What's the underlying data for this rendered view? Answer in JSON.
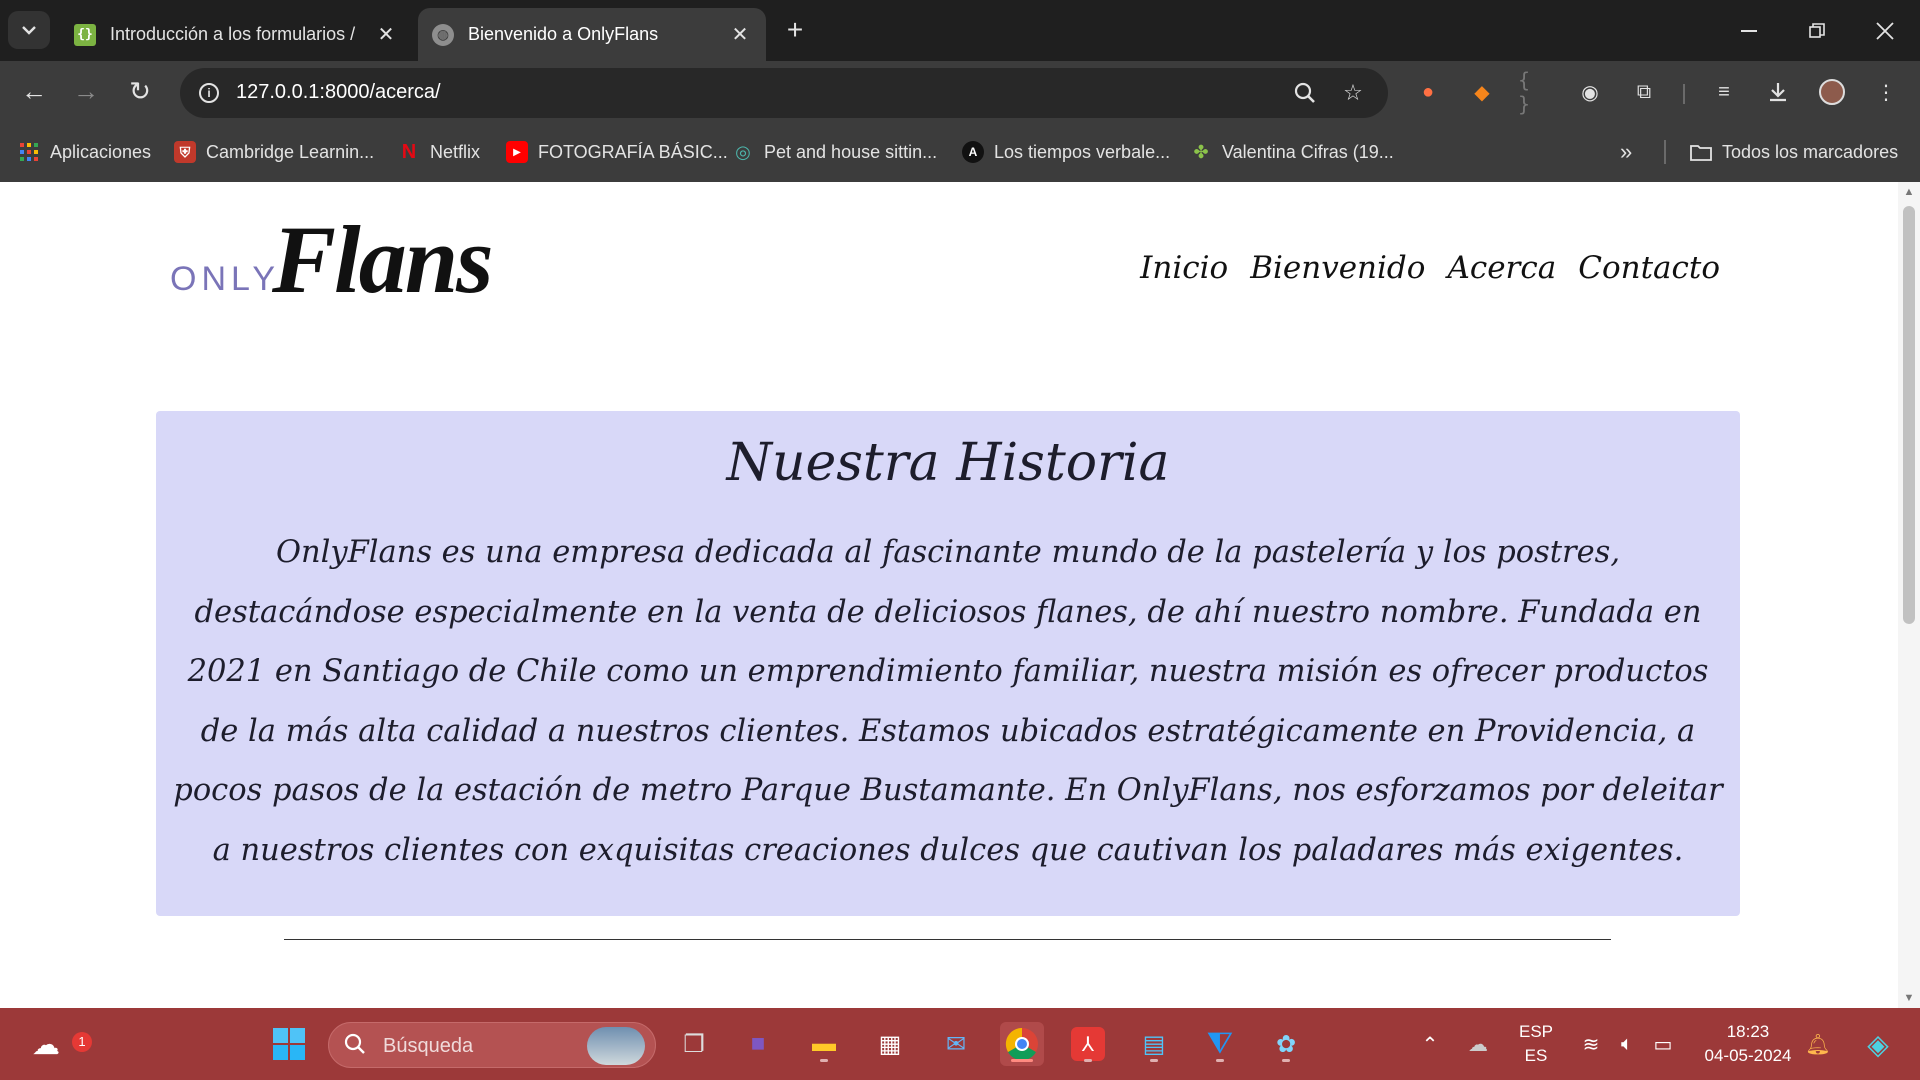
{
  "browser": {
    "tabs": [
      {
        "title": "Introducción a los formularios /",
        "favicon": "braces-icon",
        "active": false
      },
      {
        "title": "Bienvenido a OnlyFlans",
        "favicon": "globe-icon",
        "active": true
      }
    ],
    "address": "127.0.0.1:8000/acerca/",
    "bookmarks": [
      {
        "label": "Aplicaciones",
        "icon": "apps-grid-icon"
      },
      {
        "label": "Cambridge Learnin...",
        "icon": "cambridge-shield-icon"
      },
      {
        "label": "Netflix",
        "icon": "netflix-icon"
      },
      {
        "label": "FOTOGRAFÍA BÁSIC...",
        "icon": "youtube-icon"
      },
      {
        "label": "Pet and house sittin...",
        "icon": "compass-icon"
      },
      {
        "label": "Los tiempos verbale...",
        "icon": "letter-a-icon"
      },
      {
        "label": "Valentina Cifras (19...",
        "icon": "plant-icon"
      }
    ],
    "all_bookmarks": "Todos los marcadores",
    "colors": {
      "tabstrip": "#1f1f1f",
      "toolbar": "#3c3c3c",
      "omnibox": "#282828"
    }
  },
  "site": {
    "logo": {
      "prefix": "ONLY",
      "name": "Flans"
    },
    "nav": [
      "Inicio",
      "Bienvenido",
      "Acerca",
      "Contacto"
    ],
    "section_title": "Nuestra Historia",
    "section_body": "OnlyFlans es una empresa dedicada al fascinante mundo de la pastelería y los postres, destacándose especialmente en la venta de deliciosos flanes, de ahí nuestro nombre. Fundada en 2021 en Santiago de Chile como un emprendimiento familiar, nuestra misión es ofrecer productos de la más alta calidad a nuestros clientes. Estamos ubicados estratégicamente en Providencia, a pocos pasos de la estación de metro Parque Bustamante. En OnlyFlans, nos esforzamos por deleitar a nuestros clientes con exquisitas creaciones dulces que cautivan los paladares más exigentes.",
    "colors": {
      "card": "#d8d8f8",
      "logo_prefix": "#7a74b8",
      "text": "#1d1d2c"
    }
  },
  "taskbar": {
    "weather_badge": "1",
    "search_placeholder": "Búsqueda",
    "lang_top": "ESP",
    "lang_bottom": "ES",
    "time": "18:23",
    "date": "04-05-2024",
    "color": "#9c3939"
  }
}
